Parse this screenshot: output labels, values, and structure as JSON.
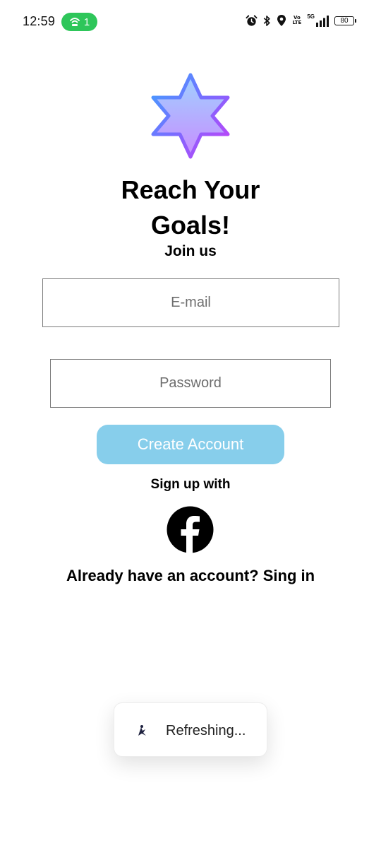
{
  "status_bar": {
    "time": "12:59",
    "hotspot_count": "1",
    "network_label": "5G",
    "volte_top": "Vo",
    "volte_bottom": "LTE",
    "battery": "80",
    "icons": [
      "alarm-icon",
      "bluetooth-icon",
      "location-icon",
      "volte-icon",
      "signal-icon",
      "battery-icon"
    ]
  },
  "header": {
    "title": "Reach Your Goals!",
    "subtitle": "Join us"
  },
  "form": {
    "email_placeholder": "E-mail",
    "email_value": "",
    "password_placeholder": "Password",
    "password_value": "",
    "create_button_label": "Create Account"
  },
  "social": {
    "label": "Sign up with",
    "provider_icon": "facebook-icon"
  },
  "footer": {
    "signin_text": "Already have an account? Sing in"
  },
  "toast": {
    "text": "Refreshing..."
  },
  "colors": {
    "button": "#87ceeb",
    "hotspot": "#2ec65a",
    "logo_gradient_start": "#4aa6ff",
    "logo_gradient_end": "#c23cf5"
  }
}
